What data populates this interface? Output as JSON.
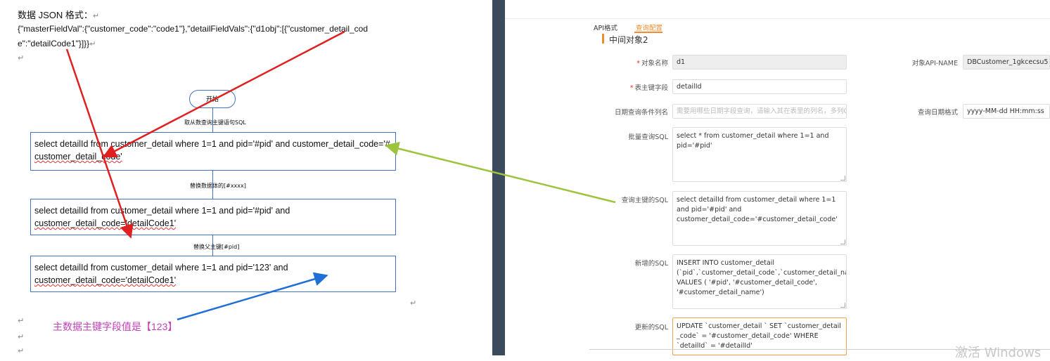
{
  "doc": {
    "heading": "数据 JSON 格式：",
    "json_line1": "{\"masterFieldVal\":{\"customer_code\":\"code1\"},\"detailFieldVals\":{\"d1obj\":[{\"customer_detail_cod",
    "json_line2": "e\":\"detailCode1\"}]}}",
    "para_mark": "↵",
    "flow": {
      "start": "开始",
      "label1": "取从数查询主键语句SQL",
      "box1_line1": "select  detailId  from  customer_detail  where  1=1  and  pid='#pid'  and  customer_detail_code='#",
      "box1_line2": "customer_detail_code'",
      "label2": "替换数据体的[#xxxx]",
      "box2_line1": "select      detailId      from      customer_detail      where      1=1      and      pid='#pid'      and",
      "box2_line2": "customer_detail_code='detailCode1'",
      "label3": "替换父主键[#pid]",
      "box3_line1": "select      detailId      from      customer_detail      where      1=1      and      pid='123'      and",
      "box3_line2": "customer_detail_code='detailCode1'"
    },
    "note": "主数据主键字段值是【123】"
  },
  "form": {
    "tabs": [
      "API格式",
      "查询配置"
    ],
    "active_tab": 1,
    "section_title": "中间对象2",
    "fields": {
      "object_name_label": "对象名称",
      "object_name_value": "d1",
      "object_api_label": "对象API-NAME",
      "object_api_value": "DBCustomer_1gkcecsu5",
      "pk_label": "表主键字段",
      "pk_value": "detailId",
      "date_cols_label": "日期查询条件列名",
      "date_cols_placeholder": "需要用哪些日期字段查询，请输入其在表里的列名，多列C",
      "date_format_label": "查询日期格式",
      "date_format_value": "yyyy-MM-dd HH:mm:ss",
      "batch_sql_label": "批量查询SQL",
      "batch_sql_value": "select * from customer_detail where 1=1 and pid='#pid'",
      "pk_sql_label": "查询主键的SQL",
      "pk_sql_value": "select detailId from customer_detail where 1=1 and pid='#pid' and customer_detail_code='#customer_detail_code'",
      "insert_sql_label": "新增的SQL",
      "insert_sql_value": "INSERT INTO customer_detail (`pid`,`customer_detail_code`,`customer_detail_name`) VALUES ( '#pid', '#customer_detail_code', '#customer_detail_name')",
      "update_sql_label": "更新的SQL",
      "update_sql_value": "UPDATE `customer_detail ` SET `customer_detail _code` = '#customer_detail_code' WHERE `detailId` = '#detailId'"
    },
    "required_mark": "*"
  },
  "watermark": "激活 Windows",
  "colors": {
    "red_arrow": "#e02020",
    "green_arrow": "#9cc43c",
    "blue_arrow": "#1f6fd6",
    "accent": "#f08c2c",
    "note": "#c23fb5"
  }
}
